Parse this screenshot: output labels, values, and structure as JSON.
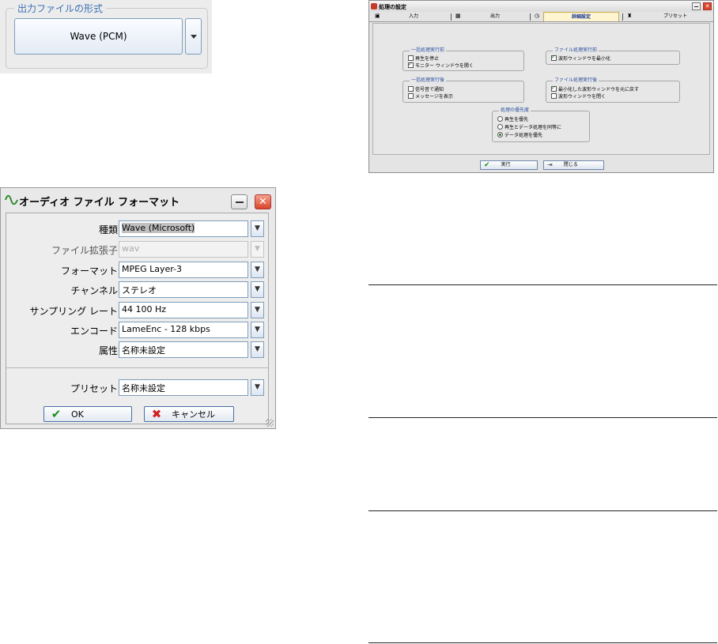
{
  "output_format": {
    "legend": "出力ファイルの形式",
    "value": "Wave (PCM)",
    "dropdown_icon": "triangle-down-icon"
  },
  "audio_file_format": {
    "title": "オーディオ ファイル フォーマット",
    "title_icon": "waveform-icon",
    "fields": [
      {
        "label": "種類",
        "value": "Wave (Microsoft)"
      },
      {
        "label": "ファイル拡張子",
        "value": "wav"
      },
      {
        "label": "フォーマット",
        "value": "MPEG Layer-3"
      },
      {
        "label": "チャンネル",
        "value": "ステレオ"
      },
      {
        "label": "サンプリング レート",
        "value": "44 100 Hz"
      },
      {
        "label": "エンコード",
        "value": "LameEnc - 128 kbps"
      },
      {
        "label": "属性",
        "value": "名称未設定"
      }
    ],
    "preset": {
      "label": "プリセット",
      "value": "名称未設定"
    },
    "ok_label": "OK",
    "cancel_label": "キャンセル"
  },
  "processing_settings": {
    "title": "処理の設定",
    "tabs": [
      "入力",
      "出力",
      "詳細設定",
      "プリセット"
    ],
    "active_tab": "詳細設定",
    "groups": {
      "before_batch": {
        "legend": "一括処理実行前",
        "options": [
          {
            "label": "再生を停止",
            "checked": false
          },
          {
            "label": "モニター ウィンドウを開く",
            "checked": true
          }
        ]
      },
      "before_file": {
        "legend": "ファイル処理実行前",
        "options": [
          {
            "label": "波形ウィンドウを最小化",
            "checked": true
          }
        ]
      },
      "after_batch": {
        "legend": "一括処理実行後",
        "options": [
          {
            "label": "信号音で通知",
            "checked": false
          },
          {
            "label": "メッセージを表示",
            "checked": false
          }
        ]
      },
      "after_file": {
        "legend": "ファイル処理実行後",
        "options": [
          {
            "label": "最小化した波形ウィンドウを元に戻す",
            "checked": true
          },
          {
            "label": "波形ウィンドウを閉く",
            "checked": false
          }
        ]
      },
      "priority": {
        "legend": "処理の優先度",
        "options": [
          {
            "label": "再生を優先",
            "selected": false
          },
          {
            "label": "再生とデータ処理を同等に",
            "selected": false
          },
          {
            "label": "データ処理を優先",
            "selected": true
          }
        ]
      }
    },
    "run_label": "実行",
    "close_label": "閉じる"
  }
}
